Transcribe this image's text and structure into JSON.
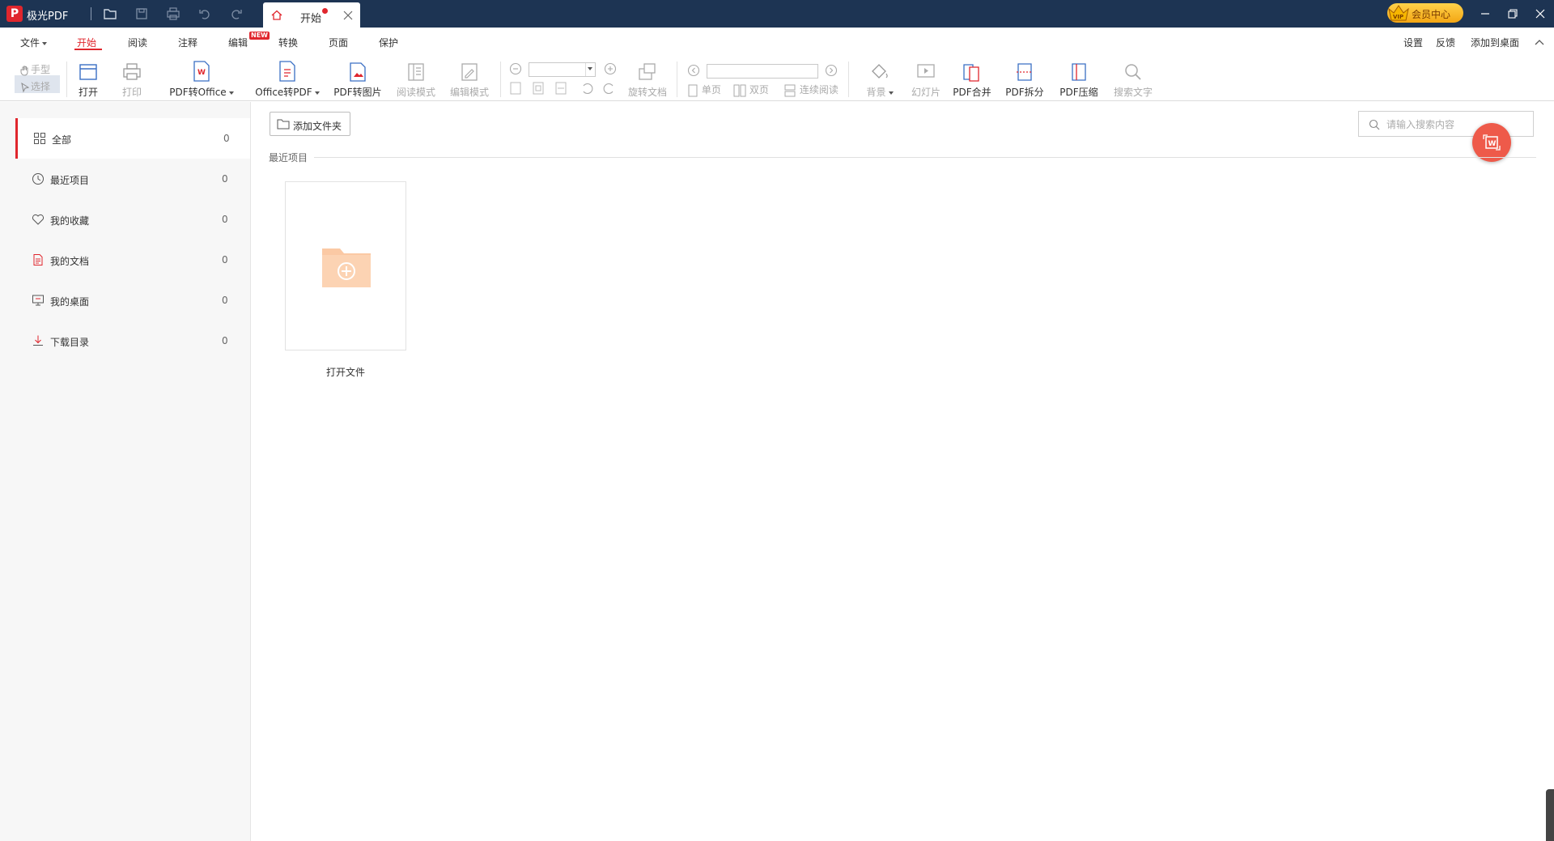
{
  "app": {
    "title": "极光PDF",
    "logo_letter": "P"
  },
  "tab": {
    "label": "开始"
  },
  "vip": {
    "label": "会员中心"
  },
  "menu": {
    "items": [
      "文件",
      "开始",
      "阅读",
      "注释",
      "编辑",
      "转换",
      "页面",
      "保护"
    ],
    "new_badge": "NEW",
    "right": [
      "设置",
      "反馈",
      "添加到桌面"
    ]
  },
  "toolbar": {
    "hand": "手型",
    "select": "选择",
    "open": "打开",
    "print": "打印",
    "pdf_to_office": "PDF转Office",
    "office_to_pdf": "Office转PDF",
    "pdf_to_image": "PDF转图片",
    "read_mode": "阅读模式",
    "edit_mode": "编辑模式",
    "rotate_doc": "旋转文档",
    "single_page": "单页",
    "double_page": "双页",
    "continuous": "连续阅读",
    "background": "背景",
    "slideshow": "幻灯片",
    "pdf_merge": "PDF合并",
    "pdf_split": "PDF拆分",
    "pdf_compress": "PDF压缩",
    "search_text": "搜索文字"
  },
  "sidebar": {
    "items": [
      {
        "label": "全部",
        "count": "0"
      },
      {
        "label": "最近项目",
        "count": "0"
      },
      {
        "label": "我的收藏",
        "count": "0"
      },
      {
        "label": "我的文档",
        "count": "0"
      },
      {
        "label": "我的桌面",
        "count": "0"
      },
      {
        "label": "下载目录",
        "count": "0"
      }
    ]
  },
  "main": {
    "add_folder": "添加文件夹",
    "search_placeholder": "请输入搜索内容",
    "section_title": "最近项目",
    "open_file": "打开文件"
  },
  "colors": {
    "accent": "#e0262d",
    "titlebar": "#1d3453",
    "folder": "#fbc9a4"
  }
}
